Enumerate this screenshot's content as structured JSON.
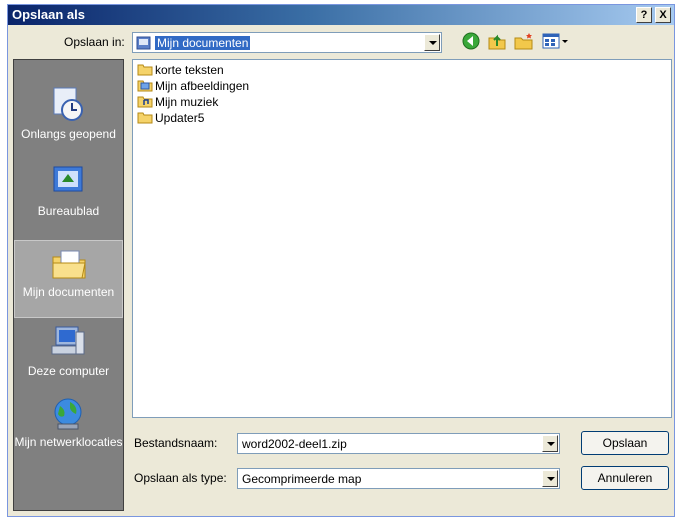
{
  "title": "Opslaan als",
  "titlebar_buttons": {
    "help": "?",
    "close": "X"
  },
  "save_in": {
    "label": "Opslaan in:",
    "value": "Mijn documenten"
  },
  "places": [
    {
      "label": "Onlangs geopend"
    },
    {
      "label": "Bureaublad"
    },
    {
      "label": "Mijn documenten"
    },
    {
      "label": "Deze computer"
    },
    {
      "label": "Mijn netwerklocaties"
    }
  ],
  "files": [
    {
      "name": "korte teksten"
    },
    {
      "name": "Mijn afbeeldingen"
    },
    {
      "name": "Mijn muziek"
    },
    {
      "name": "Updater5"
    }
  ],
  "filename": {
    "label": "Bestandsnaam:",
    "value": "word2002-deel1.zip"
  },
  "filetype": {
    "label": "Opslaan als type:",
    "value": "Gecomprimeerde map"
  },
  "buttons": {
    "save": "Opslaan",
    "cancel": "Annuleren"
  }
}
